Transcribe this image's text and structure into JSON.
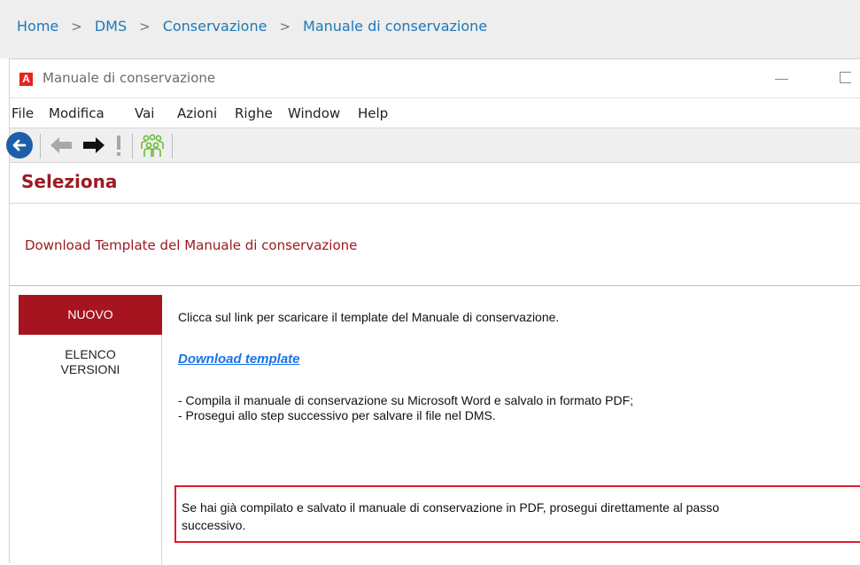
{
  "breadcrumb": {
    "items": [
      "Home",
      "DMS",
      "Conservazione",
      "Manuale di conservazione"
    ],
    "separator": ">"
  },
  "window": {
    "icon_letter": "A",
    "title": "Manuale di conservazione"
  },
  "menu": [
    "File",
    "Modifica",
    "Vai",
    "Azioni",
    "Righe",
    "Window",
    "Help"
  ],
  "toolbar": {
    "icons": [
      "back-circle-icon",
      "arrow-left-icon",
      "arrow-right-icon",
      "exclamation-icon",
      "users-group-icon"
    ]
  },
  "page": {
    "section_title": "Seleziona",
    "subtitle": "Download Template del Manuale di conservazione"
  },
  "sidebar": {
    "tabs": [
      {
        "label": "NUOVO",
        "active": true
      },
      {
        "label_line1": "ELENCO",
        "label_line2": "VERSIONI",
        "active": false
      }
    ]
  },
  "main": {
    "intro": "Clicca sul link per scaricare il template del Manuale di conservazione.",
    "download_link": "Download template",
    "bullet1": "- Compila il manuale di conservazione su Microsoft Word e salvalo in formato PDF;",
    "bullet2": "- Prosegui allo step successivo per salvare il file nel DMS.",
    "notice_line1": "Se hai già compilato e salvato il manuale di conservazione in PDF, prosegui direttamente al passo",
    "notice_line2": "successivo."
  },
  "colors": {
    "accent": "#9b1b22",
    "tab_active": "#a5141f",
    "link": "#1a73e8",
    "notice_border": "#e21b2c",
    "breadcrumb_link": "#1e78b8"
  }
}
